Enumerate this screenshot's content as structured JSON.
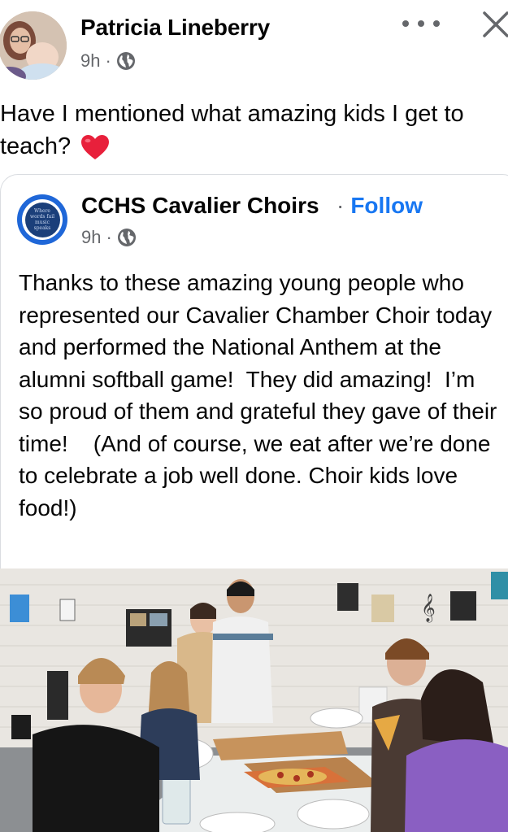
{
  "post": {
    "author": "Patricia Lineberry",
    "time": "9h",
    "separator": "·",
    "caption": "Have I mentioned what amazing kids I get to teach?",
    "heart_emoji": "red-heart"
  },
  "shared": {
    "page_name": "CCHS Cavalier Choirs",
    "follow_separator": "·",
    "follow_label": "Follow",
    "time": "9h",
    "separator": "·",
    "avatar_text": "Where words fail music speaks",
    "text": "Thanks to these amazing young people who represented our Cavalier Chamber Choir today and performed the National Anthem at the alumni softball game!  They did amazing!  I’m so proud of them and grateful they gave of their time!    (And of course, we eat after we’re done to celebrate a job well done. Choir kids love food!)"
  },
  "colors": {
    "link_blue": "#1877f2",
    "secondary_text": "#65676b",
    "heart_red": "#e8203b"
  },
  "icons": [
    "globe-icon",
    "more-options-icon",
    "close-icon",
    "heart-icon"
  ]
}
